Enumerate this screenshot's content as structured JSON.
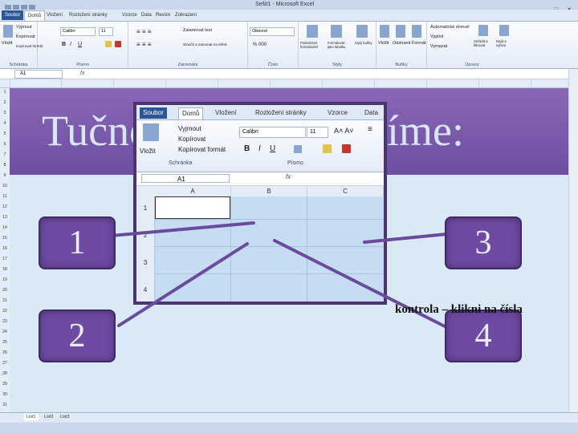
{
  "excel": {
    "window_title": "Sešit1 - Microsoft Excel",
    "tabs": [
      "Soubor",
      "Domů",
      "Vložení",
      "Rozložení stránky",
      "Vzorce",
      "Data",
      "Revize",
      "Zobrazení"
    ],
    "clipboard": {
      "cut": "Vyjmout",
      "copy": "Kopírovat",
      "painter": "Kopírovat formát",
      "group": "Schránka",
      "paste": "Vložit"
    },
    "font": {
      "name": "Calibri",
      "size": "11",
      "group": "Písmo"
    },
    "alignment": {
      "wrap": "Zalamovat text",
      "merge": "Sloučit a zarovnat na střed",
      "group": "Zarovnání"
    },
    "number": {
      "format": "Obecné",
      "group": "Číslo"
    },
    "styles": {
      "conditional": "Podmíněné formátování",
      "table": "Formátovat jako tabulku",
      "cell": "Styly buňky",
      "group": "Styly"
    },
    "cells": {
      "insert": "Vložit",
      "delete": "Odstranit",
      "format": "Formát",
      "group": "Buňky"
    },
    "editing": {
      "autosum": "Automatické shrnutí",
      "fill": "Vyplnit",
      "clear": "Vymazat",
      "sort": "Seřadit a filtrovat",
      "find": "Najít a vybrat",
      "group": "Úpravy"
    },
    "name_box": "A1",
    "fx": "fx",
    "sheet_tabs": [
      "List1",
      "List2",
      "List3"
    ]
  },
  "slide": {
    "heading": "Tučné písmo nastavíme:",
    "callouts": [
      "1",
      "2",
      "3",
      "4"
    ],
    "note": "kontrola – klikni na čísla"
  },
  "inner": {
    "tabs": [
      "Soubor",
      "Domů",
      "Vložení",
      "Rozložení stránky",
      "Vzorce",
      "Data"
    ],
    "cut": "Vyjmout",
    "copy": "Kopírovat",
    "painter": "Kopírovat formát",
    "paste": "Vložit",
    "clipboard_group": "Schránka",
    "font_group": "Písmo",
    "font_name": "Calibri",
    "font_size": "11",
    "name_box": "A1",
    "fx": "fx",
    "bold": "B",
    "italic": "I",
    "underline": "U",
    "columns": [
      "A",
      "B",
      "C"
    ],
    "rows": [
      "1",
      "2",
      "3",
      "4"
    ]
  },
  "colors": {
    "banner": "#7a5aad",
    "callout": "#6f4aa3",
    "slide_bg": "#dbe8f5",
    "heading": "#d8e6f5",
    "ribbon_file": "#2b5797"
  }
}
